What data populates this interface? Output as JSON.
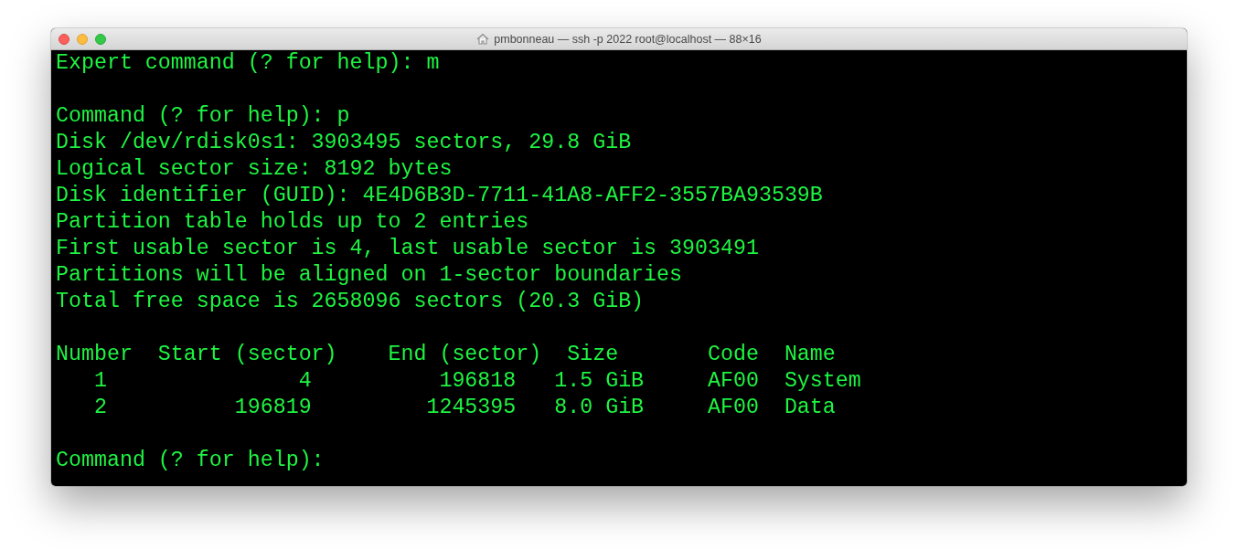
{
  "window": {
    "title": "pmbonneau — ssh -p 2022 root@localhost — 88×16"
  },
  "terminal": {
    "lines": [
      {
        "kind": "text",
        "text": "Expert command (? for help): m"
      },
      {
        "kind": "blank"
      },
      {
        "kind": "text",
        "text": "Command (? for help): p"
      },
      {
        "kind": "text",
        "text": "Disk /dev/rdisk0s1: 3903495 sectors, 29.8 GiB"
      },
      {
        "kind": "text",
        "text": "Logical sector size: 8192 bytes"
      },
      {
        "kind": "text",
        "text": "Disk identifier (GUID): 4E4D6B3D-7711-41A8-AFF2-3557BA93539B"
      },
      {
        "kind": "text",
        "text": "Partition table holds up to 2 entries"
      },
      {
        "kind": "text",
        "text": "First usable sector is 4, last usable sector is 3903491"
      },
      {
        "kind": "text",
        "text": "Partitions will be aligned on 1-sector boundaries"
      },
      {
        "kind": "text",
        "text": "Total free space is 2658096 sectors (20.3 GiB)"
      },
      {
        "kind": "blank"
      },
      {
        "kind": "text",
        "text": "Number  Start (sector)    End (sector)  Size       Code  Name"
      },
      {
        "kind": "text",
        "text": "   1               4          196818   1.5 GiB     AF00  System"
      },
      {
        "kind": "text",
        "text": "   2          196819         1245395   8.0 GiB     AF00  Data"
      },
      {
        "kind": "blank"
      },
      {
        "kind": "text",
        "text": "Command (? for help): "
      }
    ]
  }
}
